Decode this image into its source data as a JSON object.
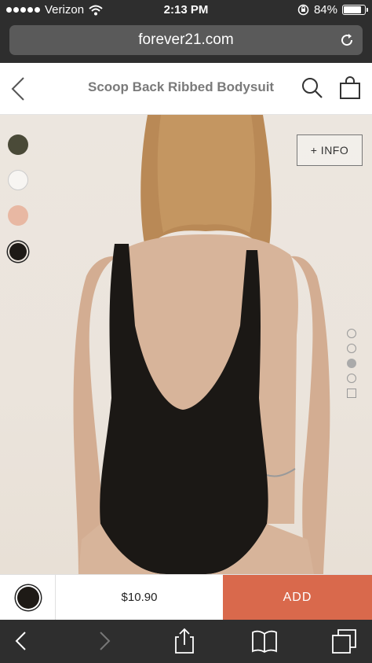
{
  "status_bar": {
    "carrier": "Verizon",
    "time": "2:13 PM",
    "battery": "84%",
    "battery_level": 0.84
  },
  "browser": {
    "url": "forever21.com"
  },
  "header": {
    "title": "Scoop Back Ribbed Bodysuit"
  },
  "product": {
    "info_label": "+ INFO",
    "swatches": [
      {
        "name": "olive",
        "color": "#4a4a38"
      },
      {
        "name": "white",
        "color": "#f7f5f2"
      },
      {
        "name": "blush",
        "color": "#e8b8a3"
      },
      {
        "name": "black",
        "color": "#1e1a16",
        "selected": true
      }
    ],
    "image_pages": 5,
    "active_page": 3
  },
  "buy_bar": {
    "price": "$10.90",
    "add_label": "ADD",
    "accent_color": "#d9694c"
  }
}
